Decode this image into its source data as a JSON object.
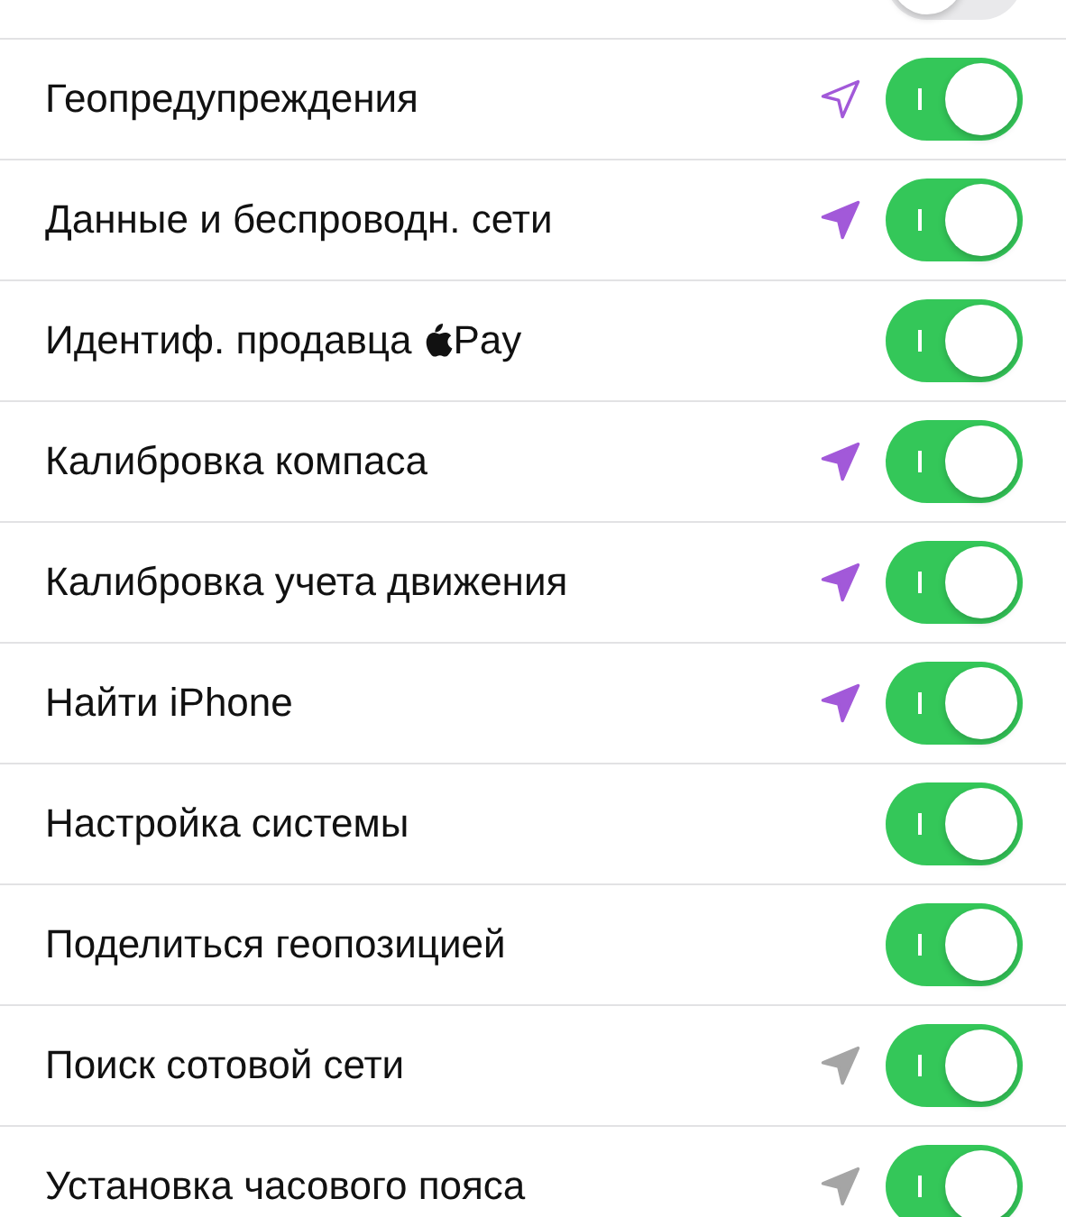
{
  "settings": [
    {
      "on": false
    },
    {
      "label": "Геопредупреждения",
      "on": true,
      "location_arrow": {
        "filled": false,
        "color": "#a259d9"
      }
    },
    {
      "label": "Данные и беспроводн. сети",
      "on": true,
      "location_arrow": {
        "filled": true,
        "color": "#a259d9"
      }
    },
    {
      "label": "Идентиф. продавца",
      "apple_logo": true,
      "label_suffix": "Pay",
      "on": true
    },
    {
      "label": "Калибровка компаса",
      "on": true,
      "location_arrow": {
        "filled": true,
        "color": "#a259d9"
      }
    },
    {
      "label": "Калибровка учета движения",
      "on": true,
      "location_arrow": {
        "filled": true,
        "color": "#a259d9"
      }
    },
    {
      "label": "Найти iPhone",
      "on": true,
      "location_arrow": {
        "filled": true,
        "color": "#a259d9"
      }
    },
    {
      "label": "Настройка системы",
      "on": true
    },
    {
      "label": "Поделиться геопозицией",
      "on": true
    },
    {
      "label": "Поиск сотовой сети",
      "on": true,
      "location_arrow": {
        "filled": true,
        "color": "#a5a5a5"
      }
    },
    {
      "label": "Установка часового пояса",
      "on": true,
      "location_arrow": {
        "filled": true,
        "color": "#a5a5a5"
      }
    }
  ]
}
